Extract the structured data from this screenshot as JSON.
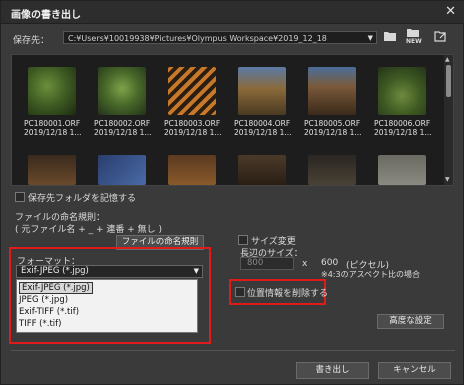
{
  "window": {
    "title": "画像の書き出し",
    "close_glyph": "✕"
  },
  "save_to": {
    "label": "保存先：",
    "path": "C:¥Users¥10019938¥Pictures¥Olympus Workspace¥2019_12_18",
    "new_label": "NEW"
  },
  "thumbnails": [
    {
      "name": "PC180001.ORF",
      "date": "2019/12/18 1..."
    },
    {
      "name": "PC180002.ORF",
      "date": "2019/12/18 1..."
    },
    {
      "name": "PC180003.ORF",
      "date": "2019/12/18 1..."
    },
    {
      "name": "PC180004.ORF",
      "date": "2019/12/18 1..."
    },
    {
      "name": "PC180005.ORF",
      "date": "2019/12/18 1..."
    },
    {
      "name": "PC180006.ORF",
      "date": "2019/12/18 1..."
    }
  ],
  "remember_folder": "保存先フォルダを記憶する",
  "naming": {
    "label": "ファイルの命名規則：",
    "example": "( 元ファイル名 + _ + 連番 + 無し )",
    "button": "ファイルの命名規則"
  },
  "format": {
    "label": "フォーマット：",
    "selected": "Exif-JPEG (*.jpg)",
    "options": [
      "Exif-JPEG (*.jpg)",
      "JPEG (*.jpg)",
      "Exif-TIFF (*.tif)",
      "TIFF (*.tif)"
    ]
  },
  "resize": {
    "label": "サイズ変更",
    "long_side_label": "長辺のサイズ：",
    "width": "800",
    "times": "x",
    "height": "600",
    "unit": "(ピクセル)",
    "note": "※4:3のアスペクト比の場合"
  },
  "remove_location": "位置情報を削除する",
  "advanced_button": "高度な設定",
  "export_button": "書き出し",
  "cancel_button": "キャンセル"
}
